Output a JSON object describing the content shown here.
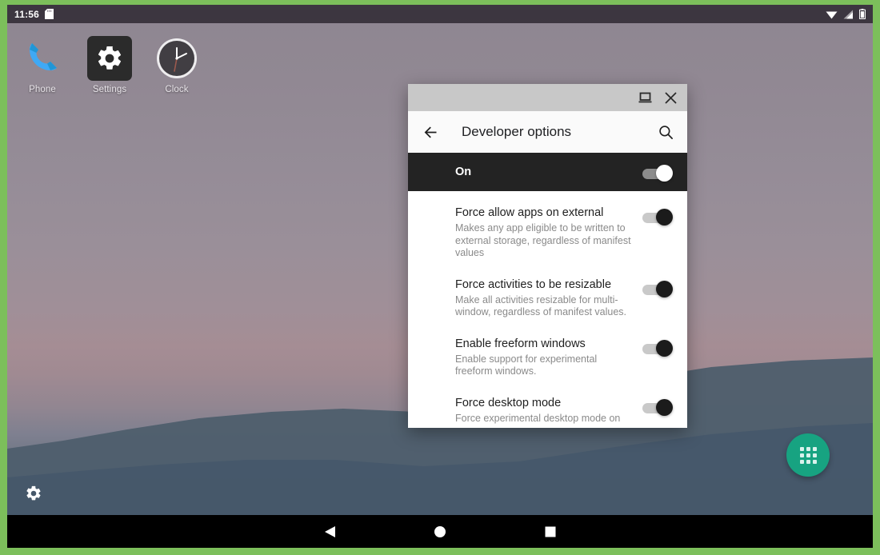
{
  "frame": {
    "border_color": "#7cbf5b"
  },
  "status_bar": {
    "time": "11:56",
    "icons": [
      "sd-card-icon",
      "wifi-icon",
      "cell-signal-icon",
      "battery-icon"
    ]
  },
  "home_screen": {
    "apps": [
      {
        "label": "Phone",
        "icon": "phone-icon"
      },
      {
        "label": "Settings",
        "icon": "gear-icon"
      },
      {
        "label": "Clock",
        "icon": "clock-icon"
      }
    ],
    "settings_shortcut_icon": "gear-icon",
    "app_drawer": {
      "icon": "apps-grid-icon",
      "color": "#17a381"
    }
  },
  "window": {
    "title_bar": {
      "restore_label": "restore-window-icon",
      "close_label": "close-window-icon"
    },
    "app_bar": {
      "back_icon": "back-arrow-icon",
      "title": "Developer options",
      "search_icon": "search-icon"
    },
    "master_switch": {
      "label": "On",
      "state": "on"
    },
    "settings": [
      {
        "title": "Force allow apps on external",
        "desc": "Makes any app eligible to be written to external storage, regardless of manifest values",
        "state": "on"
      },
      {
        "title": "Force activities to be resizable",
        "desc": "Make all activities resizable for multi-window, regardless of manifest values.",
        "state": "on"
      },
      {
        "title": "Enable freeform windows",
        "desc": "Enable support for experimental freeform windows.",
        "state": "on"
      },
      {
        "title": "Force desktop mode",
        "desc": "Force experimental desktop mode on",
        "state": "on"
      }
    ]
  },
  "nav_bar": {
    "buttons": [
      {
        "name": "back",
        "icon": "back-triangle-icon"
      },
      {
        "name": "home",
        "icon": "home-circle-icon"
      },
      {
        "name": "recents",
        "icon": "recents-square-icon"
      }
    ]
  }
}
